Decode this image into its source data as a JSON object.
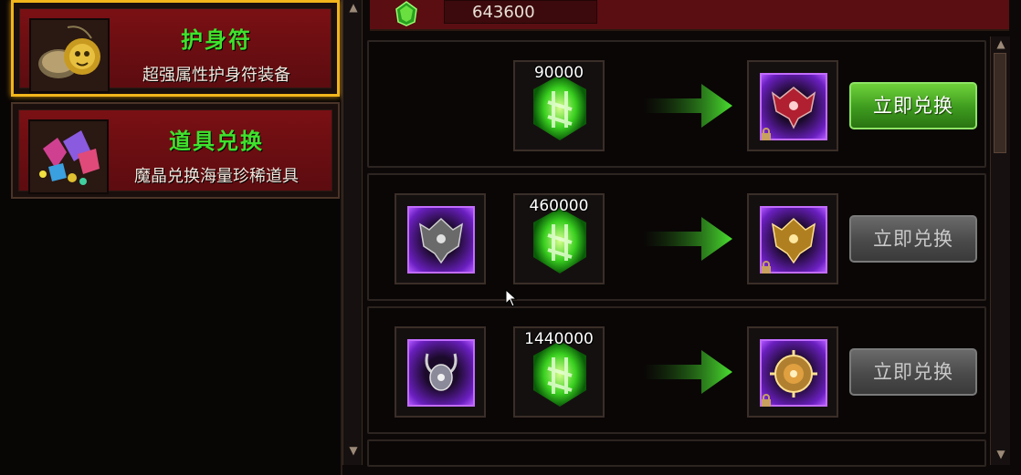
{
  "currency": {
    "icon": "green-gem-icon",
    "value": "643600"
  },
  "categories": [
    {
      "title": "护身符",
      "desc": "超强属性护身符装备",
      "icon": "amulet-icon",
      "selected": true
    },
    {
      "title": "道具兑换",
      "desc": "魔晶兑换海量珍稀道具",
      "icon": "crystals-icon",
      "selected": false
    }
  ],
  "exchanges": [
    {
      "input_item": null,
      "cost": "90000",
      "reward": "red-demon-amulet-icon",
      "button": "立即兑换",
      "enabled": true
    },
    {
      "input_item": "grey-demon-amulet-icon",
      "cost": "460000",
      "reward": "gold-demon-amulet-icon",
      "button": "立即兑换",
      "enabled": false
    },
    {
      "input_item": "silver-horned-amulet-icon",
      "cost": "1440000",
      "reward": "gold-medallion-amulet-icon",
      "button": "立即兑换",
      "enabled": false
    }
  ],
  "colors": {
    "accent_green": "#3fe22d",
    "selected_border": "#f2b51b",
    "panel_red": "#7a1014",
    "purple_frame": "#c26cff"
  }
}
